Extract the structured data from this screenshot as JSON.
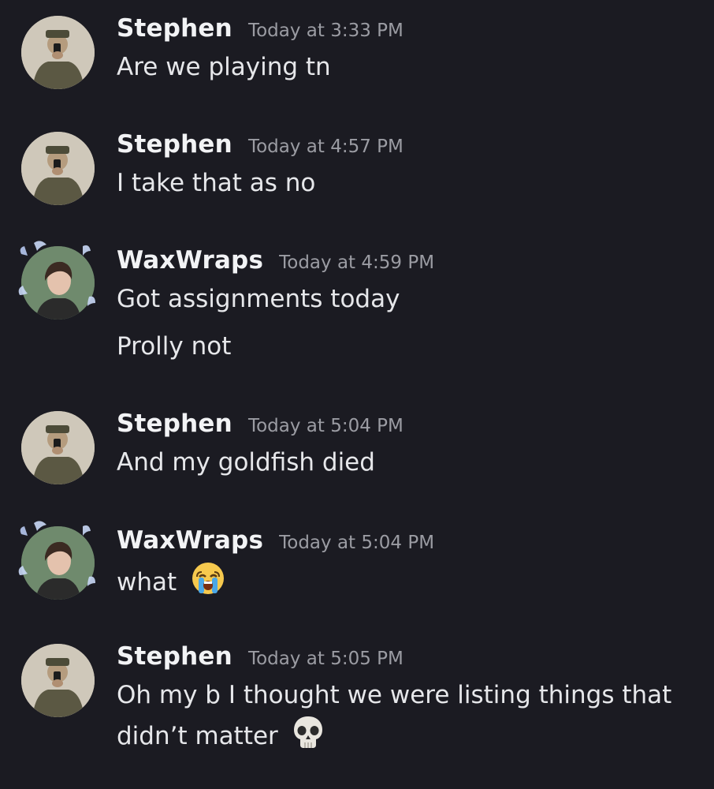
{
  "messages": [
    {
      "author": "Stephen",
      "timestamp": "Today at 3:33 PM",
      "lines": [
        "Are we playing tn"
      ]
    },
    {
      "author": "Stephen",
      "timestamp": "Today at 4:57 PM",
      "lines": [
        "I take that as no"
      ]
    },
    {
      "author": "WaxWraps",
      "timestamp": "Today at 4:59 PM",
      "lines": [
        "Got assignments today",
        "Prolly not"
      ]
    },
    {
      "author": "Stephen",
      "timestamp": "Today at 5:04 PM",
      "lines": [
        "And my goldfish died"
      ]
    },
    {
      "author": "WaxWraps",
      "timestamp": "Today at 5:04 PM",
      "lines": [
        "what"
      ],
      "emoji": "loudly-crying-face-icon"
    },
    {
      "author": "Stephen",
      "timestamp": "Today at 5:05 PM",
      "lines": [
        "Oh my b I thought we were listing things that",
        "didn’t matter"
      ],
      "emoji": "skull-icon"
    }
  ],
  "colors": {
    "background": "#1b1b22",
    "username": "#f2f3f5",
    "timestamp": "#9b9ca3",
    "message_text": "#e6e7ea"
  }
}
